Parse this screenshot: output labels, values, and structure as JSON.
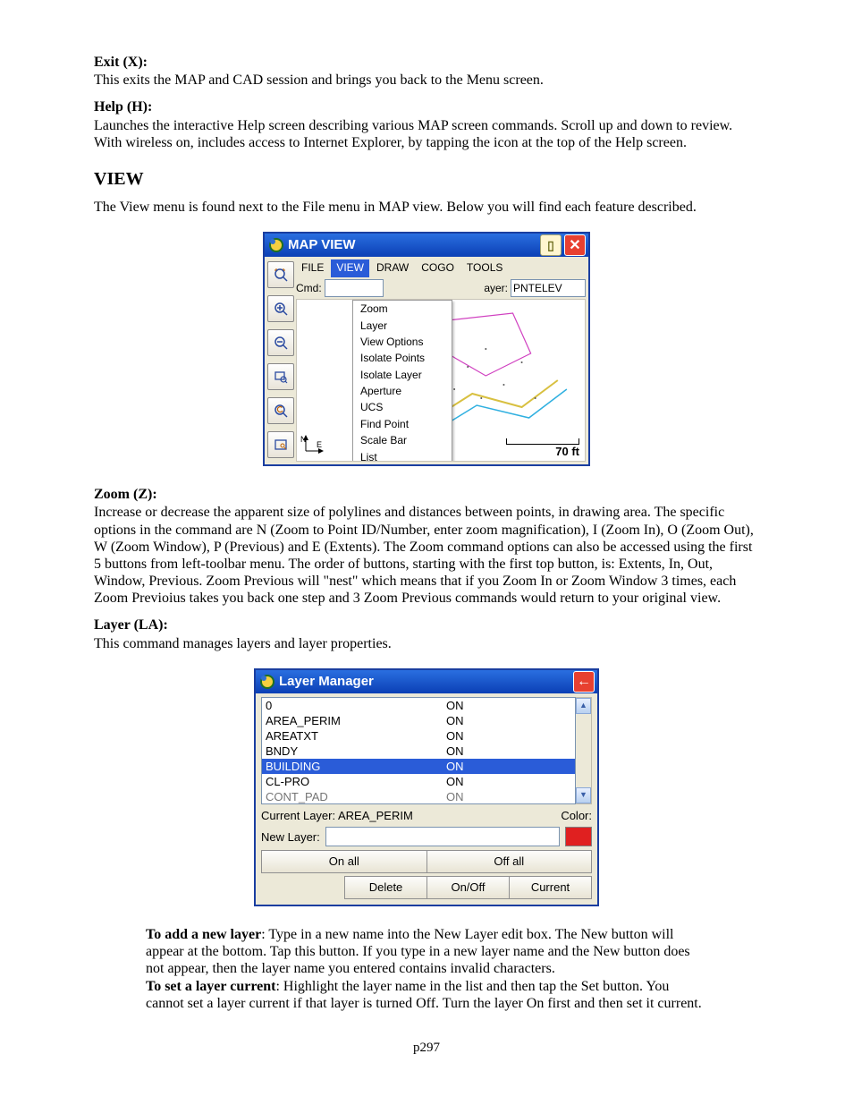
{
  "doc": {
    "exit_title": "Exit  (X):",
    "exit_body": "This exits the MAP and CAD session and brings you back to the Menu screen.",
    "help_title": "Help (H):",
    "help_body": "Launches the interactive Help screen describing various MAP screen commands.  Scroll up and down to review. With wireless on, includes access to Internet Explorer, by tapping the icon at the top of the Help screen.",
    "view_header": "VIEW",
    "view_intro": "The View menu is found next to the File menu in MAP view. Below you will find each feature described.",
    "zoom_title": "Zoom (Z):",
    "zoom_body": "Increase or decrease the apparent size of polylines and distances between points, in drawing area. The specific options in the command are N (Zoom to Point ID/Number, enter zoom magnification), I (Zoom In), O (Zoom Out), W (Zoom Window), P (Previous) and E (Extents).  The Zoom command options can also be accessed using the first 5 buttons from left-toolbar menu. The order of buttons, starting with the first top button, is: Extents, In, Out, Window, Previous. Zoom Previous will \"nest\" which means that if you Zoom In or Zoom Window 3 times, each Zoom Previoius takes you back one step and 3 Zoom Previous commands would return to your original view.",
    "layer_title": "Layer (LA):",
    "layer_body": "This command manages layers and layer properties.",
    "add_layer_bold": "To add a new layer",
    "add_layer_rest": ": Type in a new name into the New Layer edit box. The New button will appear at the bottom. Tap this button. If you type in a new layer name and the New button does not appear, then the layer name you entered contains invalid characters.",
    "set_current_bold": "To set a layer current",
    "set_current_rest": ": Highlight the layer name in the list and then tap the Set button. You cannot set a layer current if that layer is turned Off. Turn the layer On first and then set it current.",
    "page_number": "p297"
  },
  "mapview": {
    "title": "MAP VIEW",
    "menus": [
      "FILE",
      "VIEW",
      "DRAW",
      "COGO",
      "TOOLS"
    ],
    "selectedMenu": "VIEW",
    "cmd_label": "Cmd:",
    "cmd_value": "",
    "layer_label_frag": "ayer:",
    "layer_value": "PNTELEV",
    "scale_text": "70 ft",
    "dropdown": [
      "Zoom",
      "Layer",
      "View Options",
      "Isolate Points",
      "Isolate Layer",
      "Aperture",
      "UCS",
      "Find Point",
      "Scale Bar",
      "List"
    ]
  },
  "layermanager": {
    "title": "Layer Manager",
    "rows": [
      {
        "name": "0",
        "status": "ON",
        "selected": false
      },
      {
        "name": "AREA_PERIM",
        "status": "ON",
        "selected": false
      },
      {
        "name": "AREATXT",
        "status": "ON",
        "selected": false
      },
      {
        "name": "BNDY",
        "status": "ON",
        "selected": false
      },
      {
        "name": "BUILDING",
        "status": "ON",
        "selected": true
      },
      {
        "name": "CL-PRO",
        "status": "ON",
        "selected": false
      },
      {
        "name": "CONT_PAD",
        "status": "ON",
        "selected": false
      }
    ],
    "current_label": "Current Layer: AREA_PERIM",
    "color_label": "Color:",
    "newlayer_label": "New Layer:",
    "newlayer_value": "",
    "btn_onall": "On all",
    "btn_offall": "Off all",
    "btn_delete": "Delete",
    "btn_onoff": "On/Off",
    "btn_current": "Current"
  }
}
